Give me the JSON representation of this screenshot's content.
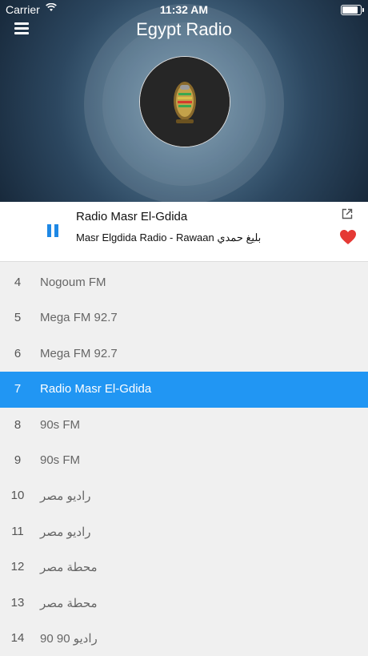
{
  "status_bar": {
    "carrier": "Carrier",
    "time": "11:32 AM"
  },
  "header": {
    "title": "Egypt Radio"
  },
  "player": {
    "station": "Radio Masr El-Gdida",
    "now_playing": "Masr Elgdida Radio - Rawaan  بليغ حمدي",
    "state": "playing",
    "favorited": true
  },
  "stations": [
    {
      "number": "4",
      "name": "Nogoum FM"
    },
    {
      "number": "5",
      "name": "Mega FM 92.7"
    },
    {
      "number": "6",
      "name": "Mega FM 92.7"
    },
    {
      "number": "7",
      "name": "Radio Masr El-Gdida",
      "active": true
    },
    {
      "number": "8",
      "name": "90s FM"
    },
    {
      "number": "9",
      "name": "90s FM"
    },
    {
      "number": "10",
      "name": "راديو مصر"
    },
    {
      "number": "11",
      "name": "راديو مصر"
    },
    {
      "number": "12",
      "name": "محطة مصر"
    },
    {
      "number": "13",
      "name": "محطة مصر"
    },
    {
      "number": "14",
      "name": "راديو 90 90"
    }
  ],
  "colors": {
    "accent": "#2196f3",
    "favorite": "#e53935",
    "play_control": "#1e88e5"
  },
  "icons": [
    "menu-icon",
    "wifi-icon",
    "battery-icon",
    "pause-icon",
    "share-icon",
    "heart-icon",
    "station-logo"
  ]
}
